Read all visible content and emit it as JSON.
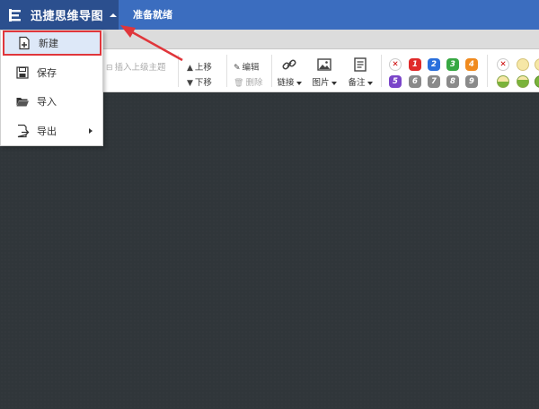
{
  "app": {
    "title": "迅捷思维导图",
    "status": "准备就绪"
  },
  "ribbon": {
    "insert_parent": "插入上级主题",
    "move_up": "上移",
    "move_down": "下移",
    "edit": "编辑",
    "delete": "删除",
    "link": "链接",
    "image": "图片",
    "note": "备注"
  },
  "priority_badges": [
    "1",
    "2",
    "3",
    "4",
    "5",
    "6",
    "7",
    "8",
    "9"
  ],
  "menu": {
    "items": [
      {
        "label": "新建",
        "icon": "new-file-icon"
      },
      {
        "label": "保存",
        "icon": "save-icon"
      },
      {
        "label": "导入",
        "icon": "folder-open-icon"
      },
      {
        "label": "导出",
        "icon": "export-icon"
      }
    ]
  },
  "colors": {
    "title_bar": "#3b6dbf",
    "app_button": "#2b4f8e",
    "highlight_border": "#e0363b",
    "canvas": "#30363a"
  }
}
